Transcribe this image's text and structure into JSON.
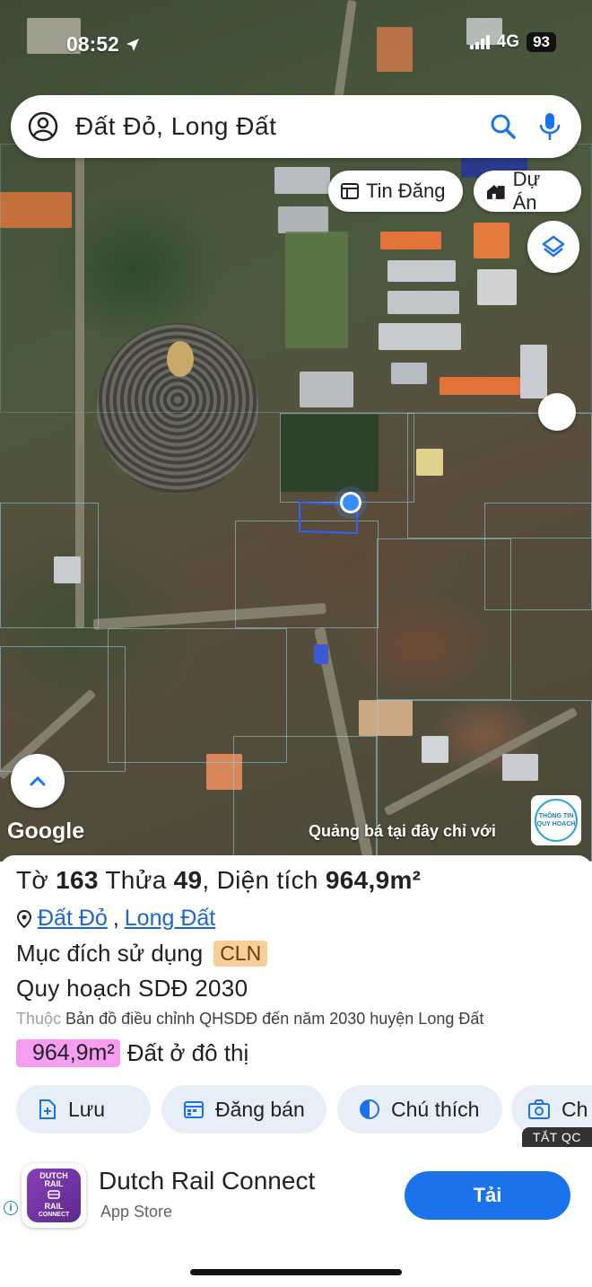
{
  "status_bar": {
    "time": "08:52",
    "network": "4G",
    "battery": "93"
  },
  "search": {
    "text": "Đất Đỏ, Long Đất"
  },
  "chips": {
    "tin_dang": "Tin Đăng",
    "du_an": "Dự Án"
  },
  "map": {
    "google_label": "Google",
    "promo_text": "Quảng bá tại đây chỉ với",
    "promo_badge_line1": "THÔNG TIN",
    "promo_badge_line2": "QUY HOẠCH"
  },
  "parcel": {
    "prefix_sheet": "Tờ",
    "sheet_no": "163",
    "prefix_lot": "Thửa",
    "lot_no": "49",
    "prefix_area": ", Diện tích",
    "area": "964,9m²",
    "district": "Đất Đỏ",
    "separator": ",",
    "province": "Long Đất",
    "usage_label": "Mục đích sử dụng",
    "usage_code": "CLN",
    "plan_title": "Quy hoạch SDĐ 2030",
    "plan_desc_prefix": "Thuộc",
    "plan_desc": "Bản đồ điều chỉnh QHSDĐ đến năm 2030 huyện Long Đất",
    "plan_area": "964,9m²",
    "plan_area_label": "Đất ở đô thị"
  },
  "actions": {
    "save": "Lưu",
    "post_sale": "Đăng bán",
    "legend": "Chú thích",
    "capture": "Ch"
  },
  "ad": {
    "close_label": "TẮT QC",
    "app_name": "Dutch Rail Connect",
    "store": "App Store",
    "cta": "Tải",
    "icon_line1": "DUTCH",
    "icon_line2": "RAIL",
    "icon_line3": "RAIL",
    "icon_line4": "CONNECT"
  },
  "colors": {
    "accent": "#1a73e8",
    "usage_badge": "#f8cf9a",
    "area_badge": "#f59ef0",
    "parcel_outline": "#2b62ff"
  }
}
